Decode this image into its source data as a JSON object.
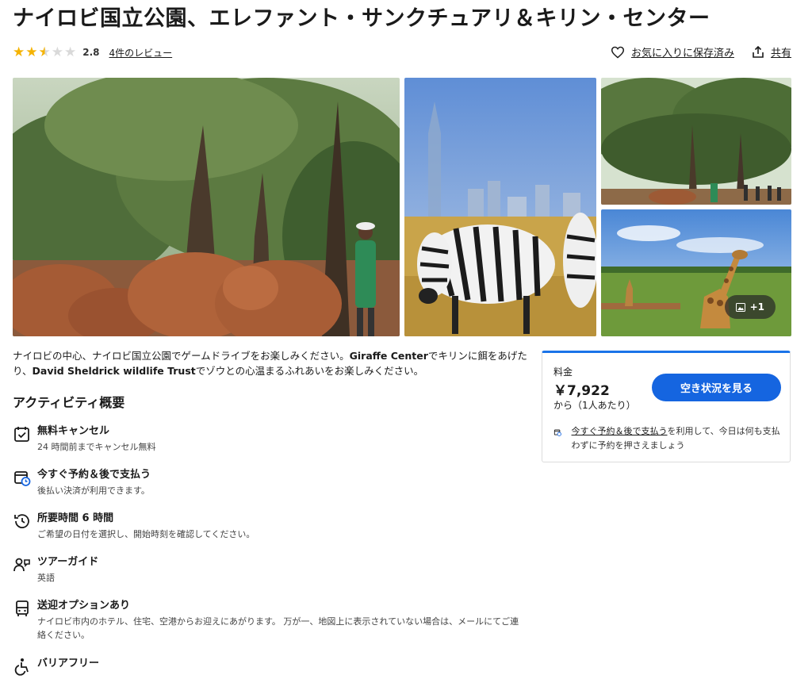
{
  "title": "ナイロビ国立公園、エレファント・サンクチュアリ＆キリン・センター",
  "rating": {
    "value": "2.8",
    "stars": 2.5,
    "reviews_link": "4件のレビュー"
  },
  "actions": {
    "favorite": "お気に入りに保存済み",
    "share": "共有"
  },
  "gallery": {
    "more_count": "+1"
  },
  "description": {
    "part1": "ナイロビの中心、ナイロビ国立公園でゲームドライブをお楽しみください。",
    "bold1": "Giraffe Center",
    "part2": "でキリンに餌をあげたり、",
    "bold2": "David Sheldrick wildlife Trust",
    "part3": "でゾウとの心温まるふれあいをお楽しみください。"
  },
  "overview": {
    "title": "アクティビティ概要",
    "features": [
      {
        "title": "無料キャンセル",
        "subtitle": "24 時間前までキャンセル無料",
        "icon": "calendar-check-icon"
      },
      {
        "title": "今すぐ予約＆後で支払う",
        "subtitle": "後払い決済が利用できます。",
        "icon": "calendar-clock-icon"
      },
      {
        "title": "所要時間 6 時間",
        "subtitle": "ご希望の日付を選択し、開始時刻を確認してください。",
        "icon": "history-clock-icon"
      },
      {
        "title": "ツアーガイド",
        "subtitle": "英語",
        "icon": "guide-person-icon"
      },
      {
        "title": "送迎オプションあり",
        "subtitle": "ナイロビ市内のホテル、住宅、空港からお迎えにあがります。 万が一、地図上に表示されていない場合は、メールにてご連絡ください。",
        "icon": "bus-icon"
      },
      {
        "title": "バリアフリー",
        "subtitle": "",
        "icon": "wheelchair-icon"
      }
    ]
  },
  "booking": {
    "price_label": "料金",
    "price": "￥7,922",
    "per": "から（1人あたり）",
    "button": "空き状況を見る",
    "note_link": "今すぐ予約＆後で支払う",
    "note_text": "を利用して、今日は何も支払わずに予約を押さえましょう"
  },
  "colors": {
    "accent": "#1565e0",
    "star": "#f5b301",
    "star_empty": "#d9d9d9"
  }
}
